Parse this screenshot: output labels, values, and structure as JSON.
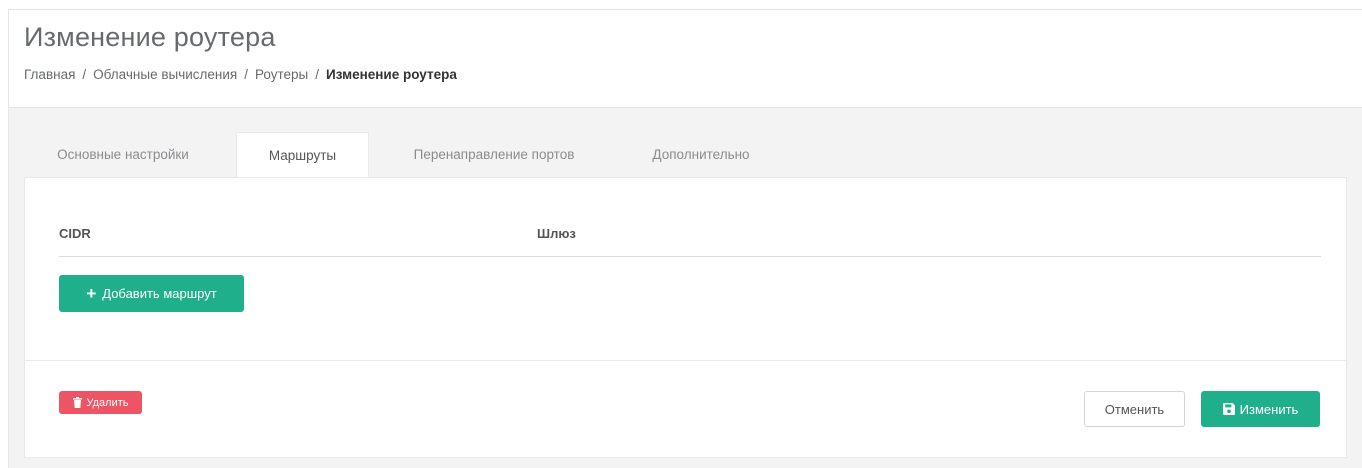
{
  "page": {
    "title": "Изменение роутера"
  },
  "breadcrumb": {
    "items": [
      "Главная",
      "Облачные вычисления",
      "Роутеры"
    ],
    "active": "Изменение роутера",
    "separator": "/"
  },
  "tabs": [
    {
      "label": "Основные настройки",
      "active": false
    },
    {
      "label": "Маршруты",
      "active": true
    },
    {
      "label": "Перенаправление портов",
      "active": false
    },
    {
      "label": "Дополнительно",
      "active": false
    }
  ],
  "routes_table": {
    "columns": [
      "CIDR",
      "Шлюз"
    ],
    "rows": []
  },
  "actions": {
    "add_route_label": "Добавить маршрут",
    "delete_label": "Удалить",
    "cancel_label": "Отменить",
    "save_label": "Изменить"
  },
  "colors": {
    "primary": "#1fb08b",
    "danger": "#ed5565",
    "background": "#f3f3f4"
  },
  "icons": {
    "add": "plus-icon",
    "delete": "trash-icon",
    "save": "floppy-disk-icon"
  }
}
